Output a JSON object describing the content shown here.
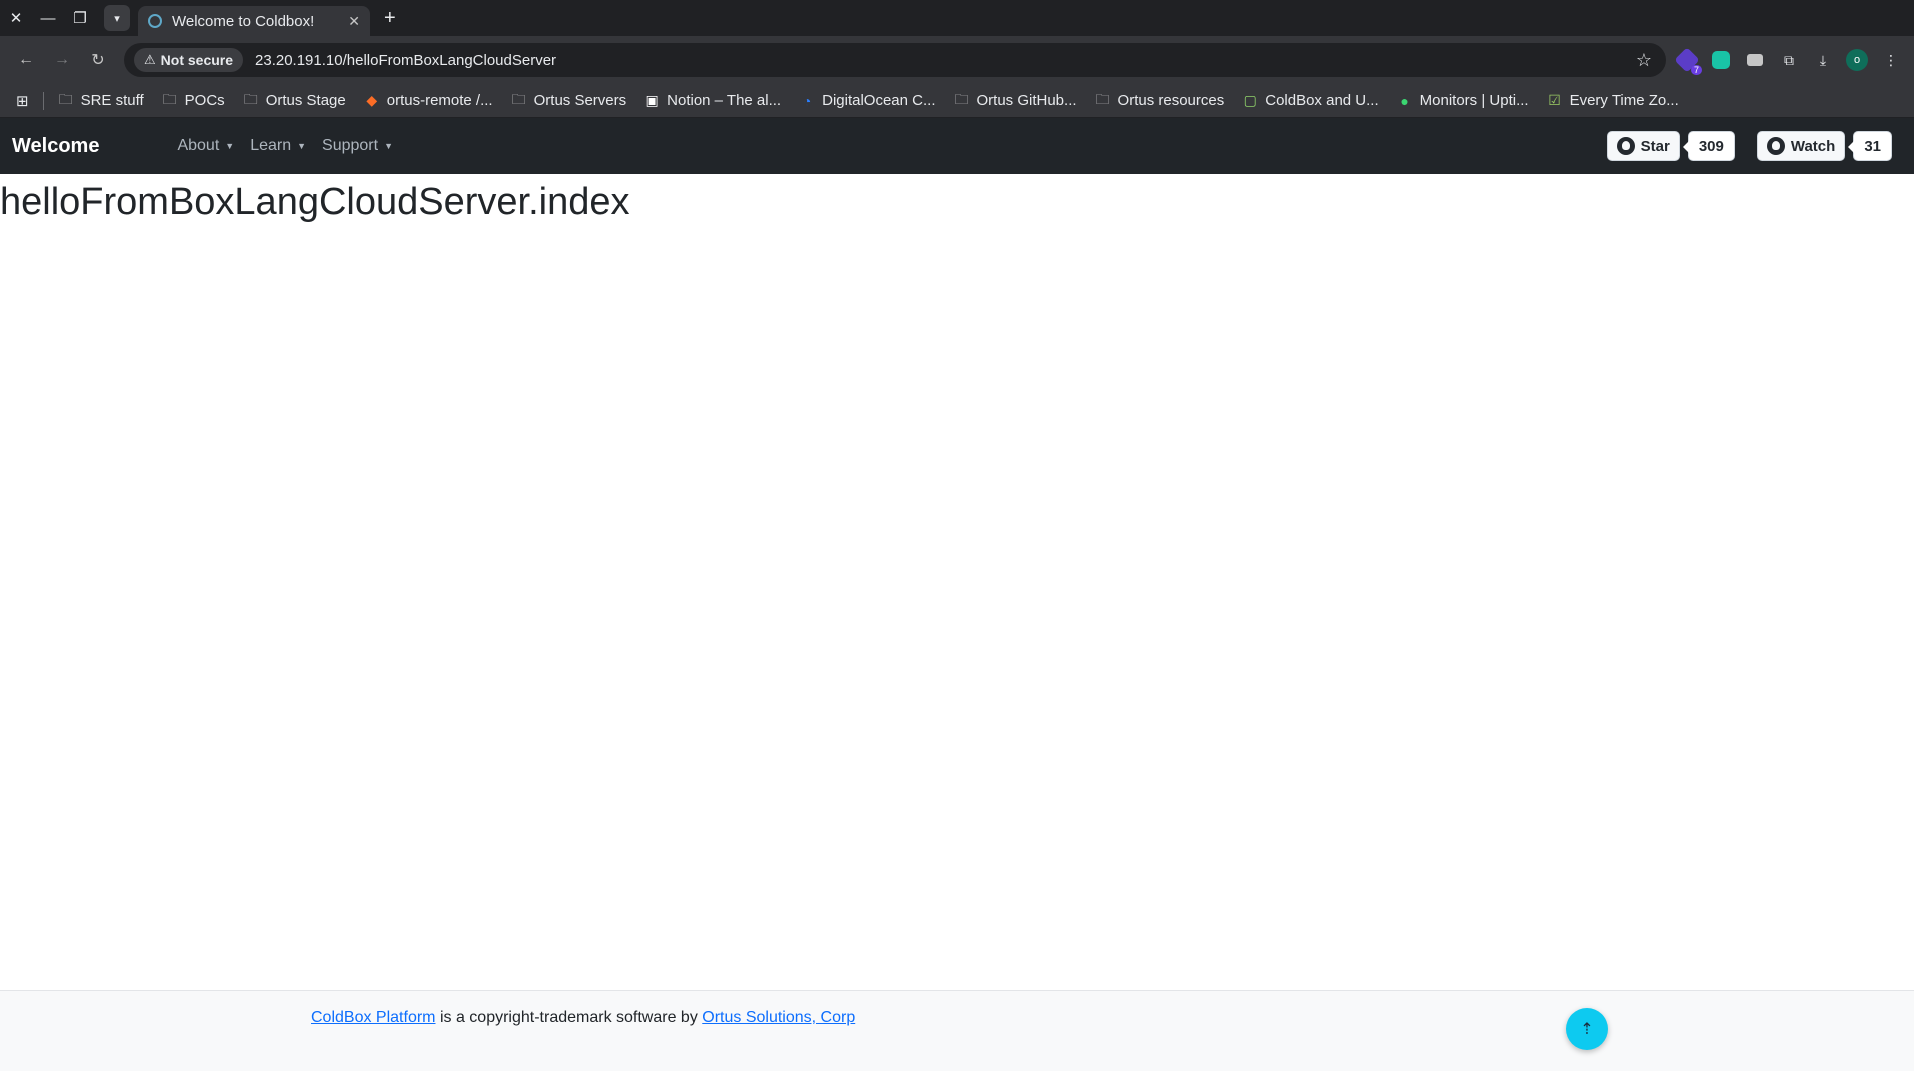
{
  "browser": {
    "tab": {
      "title": "Welcome to Coldbox!"
    },
    "omnibox": {
      "security_label": "Not secure",
      "url": "23.20.191.10/helloFromBoxLangCloudServer"
    },
    "extensions": {
      "purple_badge": "7",
      "avatar_letter": "o"
    },
    "bookmarks": [
      {
        "label": "SRE stuff",
        "icon": "folder-icon"
      },
      {
        "label": "POCs",
        "icon": "folder-icon"
      },
      {
        "label": "Ortus Stage",
        "icon": "folder-icon"
      },
      {
        "label": "ortus-remote /...",
        "icon": "gitlab-icon"
      },
      {
        "label": "Ortus Servers",
        "icon": "folder-icon"
      },
      {
        "label": "Notion – The al...",
        "icon": "notion-icon"
      },
      {
        "label": "DigitalOcean C...",
        "icon": "digitalocean-icon"
      },
      {
        "label": "Ortus GitHub...",
        "icon": "folder-icon"
      },
      {
        "label": "Ortus resources",
        "icon": "folder-icon"
      },
      {
        "label": "ColdBox and U...",
        "icon": "coldbox-icon"
      },
      {
        "label": "Monitors | Upti...",
        "icon": "uptime-dot-icon"
      },
      {
        "label": "Every Time Zo...",
        "icon": "timezone-icon"
      }
    ]
  },
  "navbar": {
    "brand": "Welcome",
    "links": [
      {
        "label": "About"
      },
      {
        "label": "Learn"
      },
      {
        "label": "Support"
      }
    ],
    "github": {
      "star_label": "Star",
      "star_count": "309",
      "watch_label": "Watch",
      "watch_count": "31"
    }
  },
  "main": {
    "heading": "helloFromBoxLangCloudServer.index"
  },
  "footer": {
    "link1": "ColdBox Platform",
    "middle": " is a copyright-trademark software by ",
    "link2": "Ortus Solutions, Corp"
  }
}
